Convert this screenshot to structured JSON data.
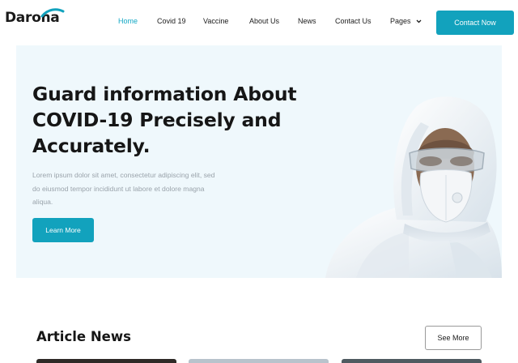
{
  "brand": {
    "name": "Darona",
    "accent": "#12a2bd"
  },
  "nav": {
    "items": [
      {
        "label": "Home",
        "active": true
      },
      {
        "label": "Covid 19",
        "active": false
      },
      {
        "label": "Vaccine",
        "active": false
      },
      {
        "label": "About Us",
        "active": false
      },
      {
        "label": "News",
        "active": false
      },
      {
        "label": "Contact Us",
        "active": false
      },
      {
        "label": "Pages",
        "active": false,
        "icon": "chevron-down-icon"
      }
    ],
    "cta_label": "Contact Now"
  },
  "hero": {
    "title_lines": [
      "Guard information About",
      "COVID-19 Precisely and",
      "Accurately."
    ],
    "description_lines": [
      "Lorem ipsum dolor sit amet, consectetur adipiscing elit, sed",
      "do eiusmod tempor incididunt ut labore et dolore magna",
      "aliqua."
    ],
    "button_label": "Learn More",
    "image": "person-in-protective-suit-with-mask"
  },
  "articles": {
    "title": "Article News",
    "see_more_label": "See More"
  }
}
